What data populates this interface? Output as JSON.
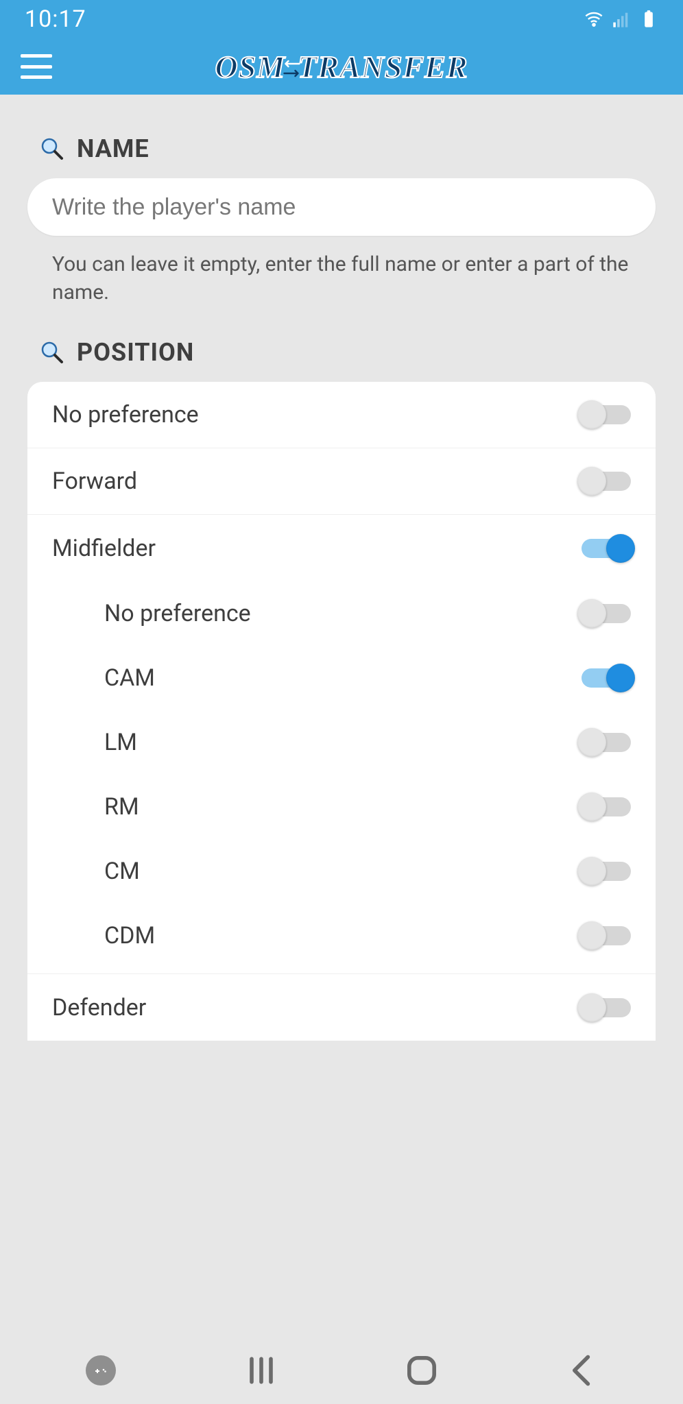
{
  "status": {
    "time": "10:17"
  },
  "app": {
    "title_left": "OSM",
    "title_right": "TRANSFER"
  },
  "sections": {
    "name": {
      "header": "NAME",
      "placeholder": "Write the player's name",
      "hint": "You can leave it empty, enter the full name or enter a part of the name."
    },
    "position": {
      "header": "POSITION",
      "options": {
        "no_pref": "No preference",
        "forward": "Forward",
        "midfielder": "Midfielder",
        "mid_no_pref": "No preference",
        "cam": "CAM",
        "lm": "LM",
        "rm": "RM",
        "cm": "CM",
        "cdm": "CDM",
        "defender": "Defender"
      },
      "state": {
        "no_pref": false,
        "forward": false,
        "midfielder": true,
        "mid_no_pref": false,
        "cam": true,
        "lm": false,
        "rm": false,
        "cm": false,
        "cdm": false,
        "defender": false
      }
    }
  }
}
